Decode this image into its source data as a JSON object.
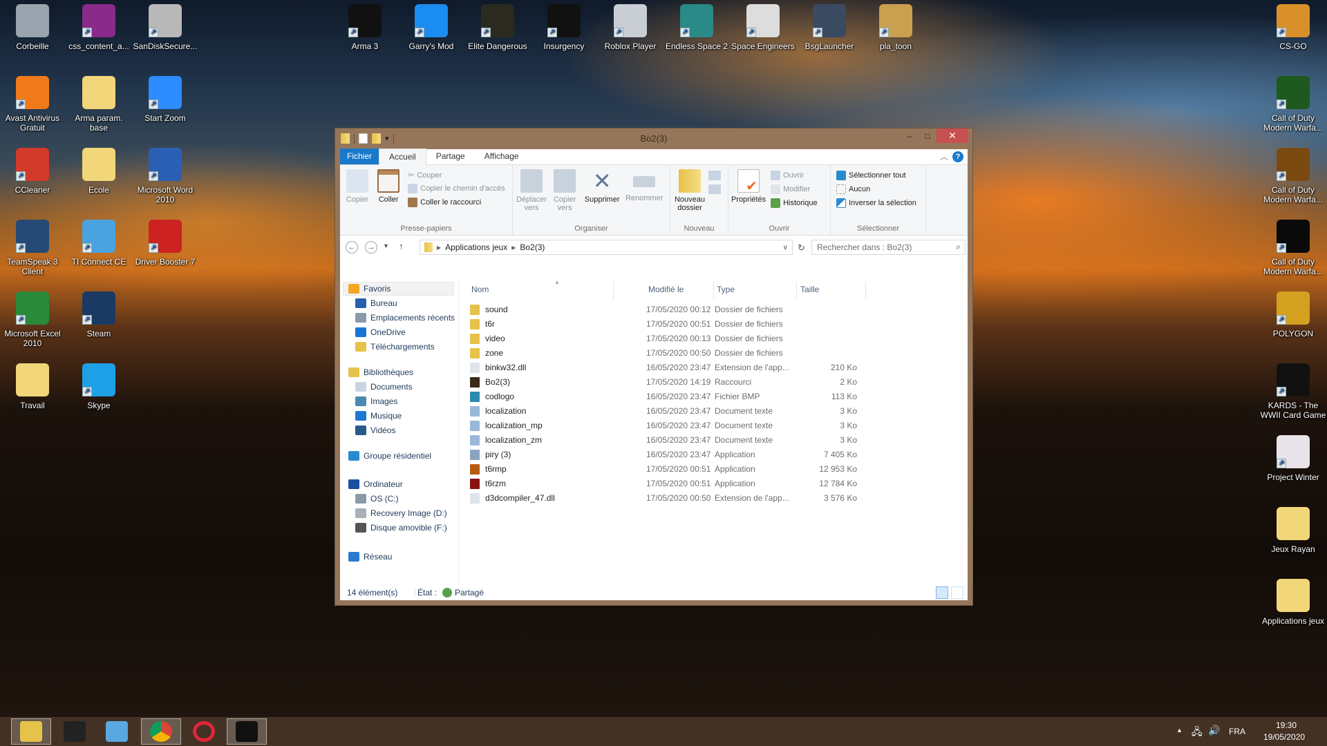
{
  "desktop": {
    "left_icons": [
      {
        "label": "Corbeille",
        "icon": "recycle-bin-icon",
        "color": "#9aa4ae"
      },
      {
        "label": "css_content_a...",
        "icon": "winrar-archive-icon",
        "color": "#8a2a8a"
      },
      {
        "label": "SanDiskSecure...",
        "icon": "safe-icon",
        "color": "#b8b8b8"
      },
      {
        "label": "Avast Antivirus Gratuit",
        "icon": "avast-icon",
        "color": "#f07a1a"
      },
      {
        "label": "Arma param. base",
        "icon": "folder-icon",
        "color": "#f2d77a"
      },
      {
        "label": "Start Zoom",
        "icon": "zoom-icon",
        "color": "#2d8cff"
      },
      {
        "label": "CCleaner",
        "icon": "ccleaner-icon",
        "color": "#d23a2a"
      },
      {
        "label": "Ecole",
        "icon": "folder-icon",
        "color": "#f2d77a"
      },
      {
        "label": "Microsoft Word 2010",
        "icon": "word-icon",
        "color": "#2b5fb4"
      },
      {
        "label": "TeamSpeak 3 Client",
        "icon": "teamspeak-icon",
        "color": "#254a75"
      },
      {
        "label": "TI Connect CE",
        "icon": "ti-connect-icon",
        "color": "#4aa3df"
      },
      {
        "label": "Driver Booster 7",
        "icon": "driver-booster-icon",
        "color": "#c22"
      },
      {
        "label": "Microsoft Excel 2010",
        "icon": "excel-icon",
        "color": "#2a8a3a"
      },
      {
        "label": "Steam",
        "icon": "steam-icon",
        "color": "#1b3a63"
      },
      {
        "label": "Travail",
        "icon": "folder-icon",
        "color": "#f2d77a"
      },
      {
        "label": "Skype",
        "icon": "skype-icon",
        "color": "#1ea0e6"
      }
    ],
    "top_icons": [
      {
        "label": "Arma 3",
        "icon": "arma3-icon",
        "color": "#111"
      },
      {
        "label": "Garry's Mod",
        "icon": "garrys-mod-icon",
        "color": "#1b8cf0"
      },
      {
        "label": "Elite Dangerous",
        "icon": "elite-dangerous-icon",
        "color": "#2a2a20"
      },
      {
        "label": "Insurgency",
        "icon": "insurgency-icon",
        "color": "#111"
      },
      {
        "label": "Roblox Player",
        "icon": "roblox-icon",
        "color": "#c9cdd4"
      },
      {
        "label": "Endless Space 2",
        "icon": "endless-space-icon",
        "color": "#2a8a88"
      },
      {
        "label": "Space Engineers",
        "icon": "space-engineers-icon",
        "color": "#ddd"
      },
      {
        "label": "BsgLauncher",
        "icon": "bsg-launcher-icon",
        "color": "#3a4a60"
      },
      {
        "label": "pla_toon",
        "icon": "pla-toon-icon",
        "color": "#c9a050"
      }
    ],
    "right_icons": [
      {
        "label": "CS-GO",
        "icon": "csgo-icon",
        "color": "#d9902a"
      },
      {
        "label": "Call of Duty Modern Warfa...",
        "icon": "cod-mw2-icon",
        "color": "#1e5a1e"
      },
      {
        "label": "Call of Duty Modern Warfa...",
        "icon": "cod-mw2-icon",
        "color": "#7a4a10"
      },
      {
        "label": "Call of Duty Modern Warfa...",
        "icon": "cod-mw-icon",
        "color": "#0a0a0a"
      },
      {
        "label": "POLYGON",
        "icon": "polygon-icon",
        "color": "#d4a020"
      },
      {
        "label": "KARDS - The WWII Card Game",
        "icon": "kards-icon",
        "color": "#111"
      },
      {
        "label": "Project Winter",
        "icon": "project-winter-icon",
        "color": "#e8e4ea"
      },
      {
        "label": "Jeux Rayan",
        "icon": "folder-icon",
        "color": "#f2d77a"
      },
      {
        "label": "Applications jeux",
        "icon": "folder-icon",
        "color": "#f2d77a"
      }
    ]
  },
  "explorer": {
    "title": "Bo2(3)",
    "window_buttons": {
      "minimize": "‒",
      "maximize": "□",
      "close": "✕"
    },
    "tabs": [
      "Fichier",
      "Accueil",
      "Partage",
      "Affichage"
    ],
    "active_tab": "Accueil",
    "help": "?",
    "ribbon": {
      "clipboard": {
        "label": "Presse-papiers",
        "copy": "Copier",
        "paste": "Coller",
        "cut": "Couper",
        "copy_path": "Copier le chemin d'accès",
        "paste_shortcut": "Coller le raccourci"
      },
      "organize": {
        "label": "Organiser",
        "move_to": "Déplacer vers",
        "copy_to": "Copier vers",
        "delete": "Supprimer",
        "rename": "Renommer"
      },
      "new": {
        "label": "Nouveau",
        "new_folder": "Nouveau dossier"
      },
      "open": {
        "label": "Ouvrir",
        "properties": "Propriétés",
        "open": "Ouvrir",
        "edit": "Modifier",
        "history": "Historique"
      },
      "select": {
        "label": "Sélectionner",
        "select_all": "Sélectionner tout",
        "none": "Aucun",
        "invert": "Inverser la sélection"
      }
    },
    "address": {
      "crumbs": [
        "Applications jeux",
        "Bo2(3)"
      ]
    },
    "search": {
      "placeholder": "Rechercher dans : Bo2(3)"
    },
    "nav": [
      {
        "label": "Favoris",
        "icon": "star-icon",
        "level": 0,
        "color": "#f5a623"
      },
      {
        "label": "Bureau",
        "icon": "desktop-icon",
        "level": 1,
        "color": "#2a5fb0"
      },
      {
        "label": "Emplacements récents",
        "icon": "recent-places-icon",
        "level": 1,
        "color": "#8a9aa8"
      },
      {
        "label": "OneDrive",
        "icon": "onedrive-icon",
        "level": 1,
        "color": "#1976d2"
      },
      {
        "label": "Téléchargements",
        "icon": "downloads-icon",
        "level": 1,
        "color": "#e7c24a"
      },
      {
        "label": "Bibliothèques",
        "icon": "libraries-icon",
        "level": 0,
        "color": "#e7c24a"
      },
      {
        "label": "Documents",
        "icon": "documents-icon",
        "level": 1,
        "color": "#c8d4e0"
      },
      {
        "label": "Images",
        "icon": "images-icon",
        "level": 1,
        "color": "#4a8ab0"
      },
      {
        "label": "Musique",
        "icon": "music-icon",
        "level": 1,
        "color": "#1e78d0"
      },
      {
        "label": "Vidéos",
        "icon": "videos-icon",
        "level": 1,
        "color": "#2a5a8a"
      },
      {
        "label": "Groupe résidentiel",
        "icon": "homegroup-icon",
        "level": 0,
        "color": "#2a8ad0"
      },
      {
        "label": "Ordinateur",
        "icon": "computer-icon",
        "level": 0,
        "color": "#1a50a0"
      },
      {
        "label": "OS (C:)",
        "icon": "drive-c-icon",
        "level": 1,
        "color": "#8a9aa8"
      },
      {
        "label": "Recovery Image (D:)",
        "icon": "drive-icon",
        "level": 1,
        "color": "#a8b0b8"
      },
      {
        "label": "Disque amovible (F:)",
        "icon": "removable-drive-icon",
        "level": 1,
        "color": "#555"
      },
      {
        "label": "Réseau",
        "icon": "network-icon",
        "level": 0,
        "color": "#2a7ad0"
      }
    ],
    "columns": [
      "Nom",
      "Modifié le",
      "Type",
      "Taille"
    ],
    "files": [
      {
        "name": "sound",
        "modified": "17/05/2020 00:12",
        "type": "Dossier de fichiers",
        "size": "",
        "icon": "folder-icon",
        "color": "#e7c24a"
      },
      {
        "name": "t6r",
        "modified": "17/05/2020 00:51",
        "type": "Dossier de fichiers",
        "size": "",
        "icon": "folder-icon",
        "color": "#e7c24a"
      },
      {
        "name": "video",
        "modified": "17/05/2020 00:13",
        "type": "Dossier de fichiers",
        "size": "",
        "icon": "folder-icon",
        "color": "#e7c24a"
      },
      {
        "name": "zone",
        "modified": "17/05/2020 00:50",
        "type": "Dossier de fichiers",
        "size": "",
        "icon": "folder-icon",
        "color": "#e7c24a"
      },
      {
        "name": "binkw32.dll",
        "modified": "16/05/2020 23:47",
        "type": "Extension de l'app...",
        "size": "210 Ko",
        "icon": "dll-icon",
        "color": "#dfe4ea"
      },
      {
        "name": "Bo2(3)",
        "modified": "17/05/2020 14:19",
        "type": "Raccourci",
        "size": "2 Ko",
        "icon": "shortcut-icon",
        "color": "#3a2a1a"
      },
      {
        "name": "codlogo",
        "modified": "16/05/2020 23:47",
        "type": "Fichier BMP",
        "size": "113 Ko",
        "icon": "image-file-icon",
        "color": "#2a8ab0"
      },
      {
        "name": "localization",
        "modified": "16/05/2020 23:47",
        "type": "Document texte",
        "size": "3 Ko",
        "icon": "text-file-icon",
        "color": "#9ab8d8"
      },
      {
        "name": "localization_mp",
        "modified": "16/05/2020 23:47",
        "type": "Document texte",
        "size": "3 Ko",
        "icon": "text-file-icon",
        "color": "#9ab8d8"
      },
      {
        "name": "localization_zm",
        "modified": "16/05/2020 23:47",
        "type": "Document texte",
        "size": "3 Ko",
        "icon": "text-file-icon",
        "color": "#9ab8d8"
      },
      {
        "name": "piry (3)",
        "modified": "16/05/2020 23:47",
        "type": "Application",
        "size": "7 405 Ko",
        "icon": "application-icon",
        "color": "#8aa4c0"
      },
      {
        "name": "t6rmp",
        "modified": "17/05/2020 00:51",
        "type": "Application",
        "size": "12 953 Ko",
        "icon": "t6rmp-icon",
        "color": "#b85a10"
      },
      {
        "name": "t6rzm",
        "modified": "17/05/2020 00:51",
        "type": "Application",
        "size": "12 784 Ko",
        "icon": "t6rzm-icon",
        "color": "#8a1010"
      },
      {
        "name": "d3dcompiler_47.dll",
        "modified": "17/05/2020 00:50",
        "type": "Extension de l'app...",
        "size": "3 576 Ko",
        "icon": "dll-icon",
        "color": "#dfe4ea"
      }
    ],
    "status": {
      "count": "14 élément(s)",
      "state_label": "État :",
      "state_value": "Partagé"
    }
  },
  "taskbar": {
    "apps": [
      {
        "name": "file-explorer",
        "icon": "file-explorer-icon",
        "color": "#e7c24a",
        "active": true
      },
      {
        "name": "puzzle-app",
        "icon": "puzzle-icon",
        "color": "#222"
      },
      {
        "name": "calculator",
        "icon": "calculator-icon",
        "color": "#5aa8e0"
      },
      {
        "name": "chrome",
        "icon": "chrome-icon",
        "color": "#db4437",
        "active": true
      },
      {
        "name": "opera",
        "icon": "opera-icon",
        "color": "#e0263a"
      },
      {
        "name": "epic-games",
        "icon": "epic-games-icon",
        "color": "#111",
        "active": true
      }
    ],
    "tray": {
      "language": "FRA",
      "time": "19:30",
      "date": "19/05/2020",
      "show_hidden": "▲",
      "network": "🖧",
      "volume": "🔊"
    }
  }
}
